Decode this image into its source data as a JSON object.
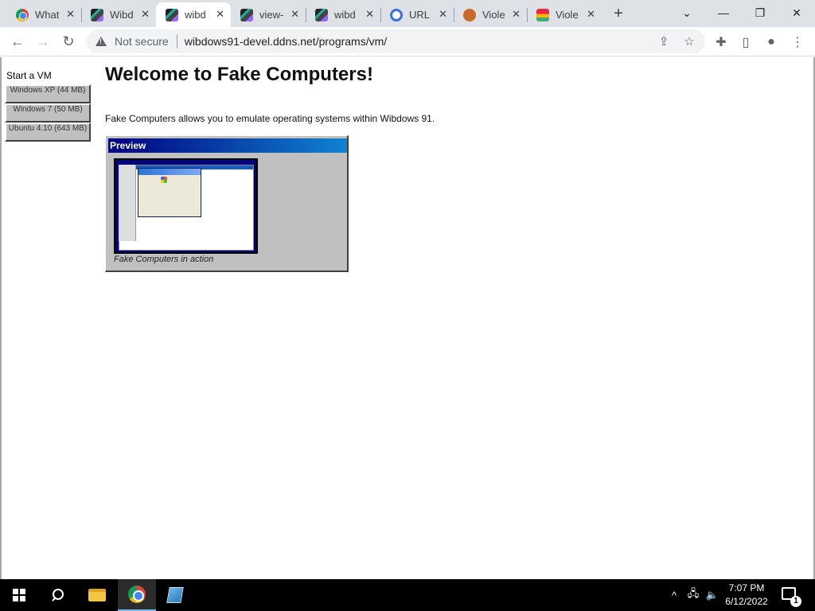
{
  "browser": {
    "tabs": [
      {
        "title": "What",
        "favicon": "chrome-icon",
        "active": false
      },
      {
        "title": "Wibd",
        "favicon": "wibdows-icon",
        "active": false
      },
      {
        "title": "wibd",
        "favicon": "wibdows-icon",
        "active": true
      },
      {
        "title": "view-",
        "favicon": "wibdows-icon",
        "active": false
      },
      {
        "title": "wibd",
        "favicon": "wibdows-icon",
        "active": false
      },
      {
        "title": "URL S",
        "favicon": "url-icon",
        "active": false
      },
      {
        "title": "Viole",
        "favicon": "violentmonkey-icon",
        "active": false
      },
      {
        "title": "Viole",
        "favicon": "violentmonkey-icon",
        "active": false
      }
    ],
    "security_label": "Not secure",
    "url": "wibdows91-devel.ddns.net/programs/vm/"
  },
  "page": {
    "sidebar_title": "Start a VM",
    "vm_buttons": [
      {
        "label": "Windows XP (44 MB)"
      },
      {
        "label": "Windows 7 (50 MB)"
      },
      {
        "label": "Ubuntu 4.10 (643 MB)"
      }
    ],
    "heading": "Welcome to Fake Computers!",
    "intro": "Fake Computers allows you to emulate operating systems within Wibdows 91.",
    "preview_title": "Preview",
    "preview_caption": "Fake Computers in action"
  },
  "taskbar": {
    "time": "7:07 PM",
    "date": "6/12/2022",
    "notification_count": "1"
  }
}
